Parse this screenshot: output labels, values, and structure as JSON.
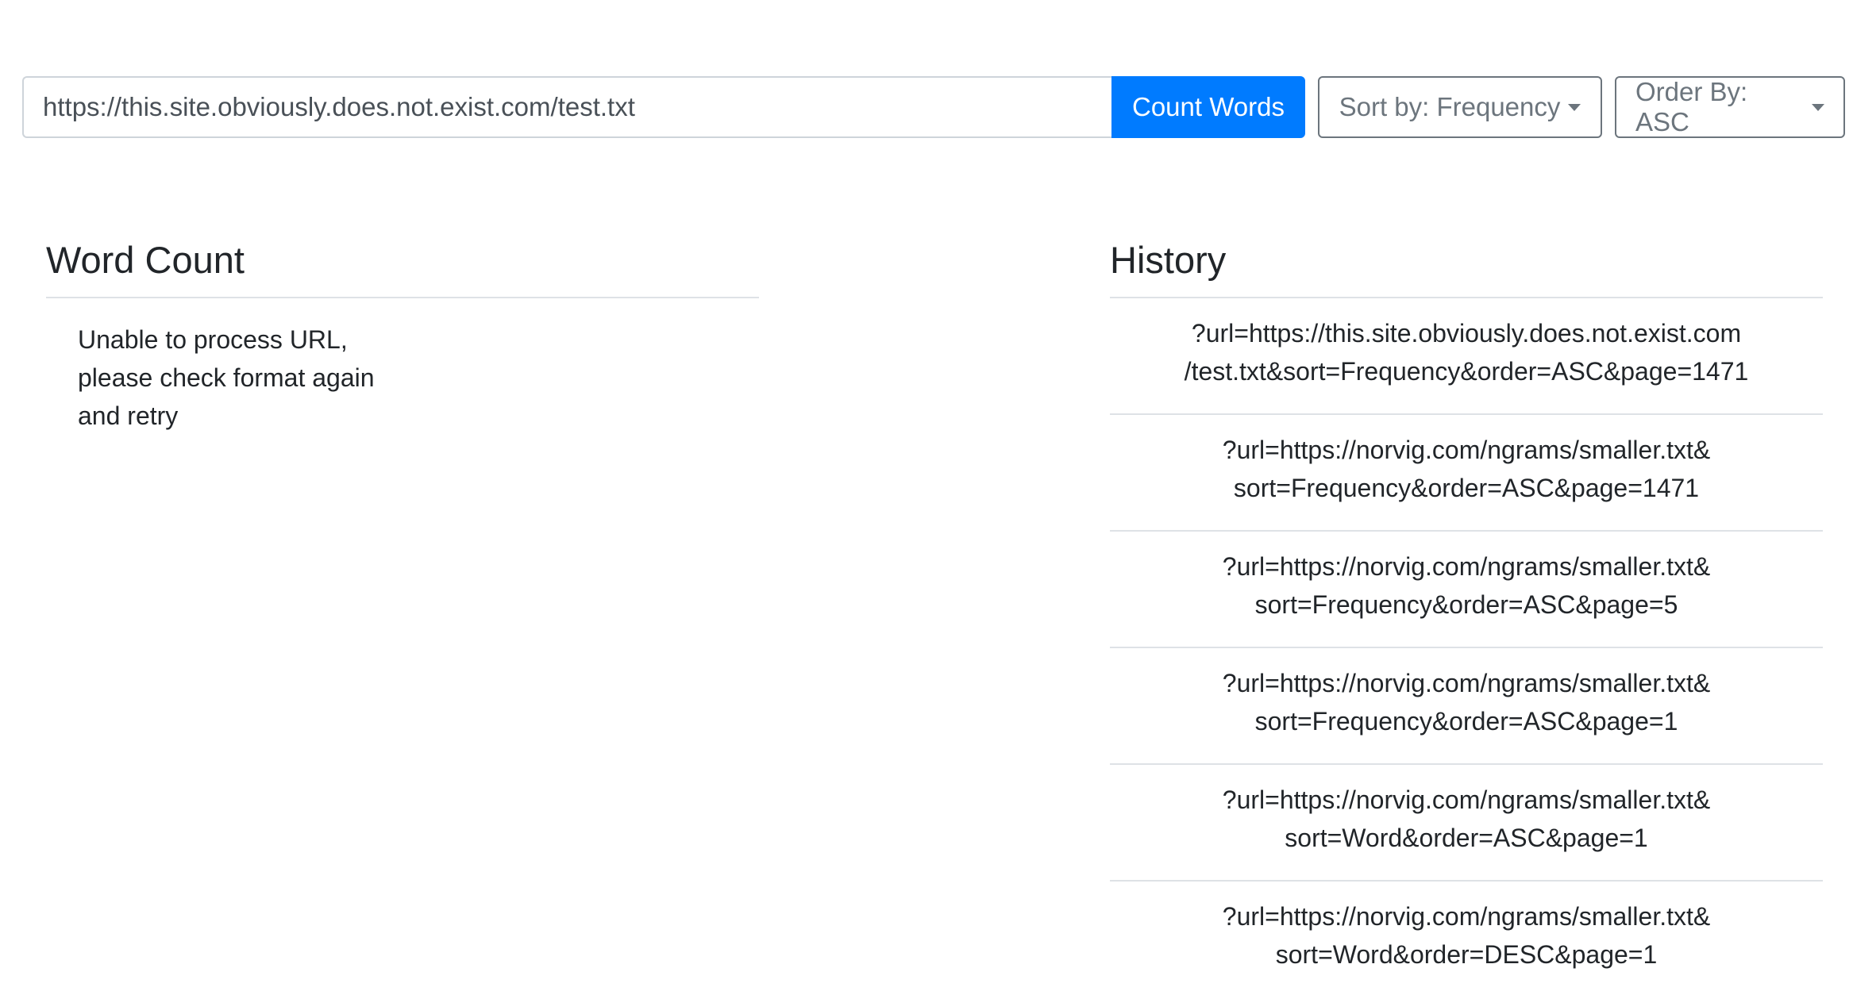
{
  "toolbar": {
    "url_value": "https://this.site.obviously.does.not.exist.com/test.txt",
    "count_button_label": "Count Words",
    "sort_dropdown_label": "Sort by: Frequency",
    "order_dropdown_label": "Order By: ASC",
    "accent_color": "#007bff"
  },
  "word_count": {
    "title": "Word Count",
    "error_message": "Unable to process URL, please check format again and retry"
  },
  "history": {
    "title": "History",
    "items": [
      {
        "line1": "?url=https://this.site.obviously.does.not.exist.com",
        "line2": "/test.txt&sort=Frequency&order=ASC&page=1471"
      },
      {
        "line1": "?url=https://norvig.com/ngrams/smaller.txt&",
        "line2": "sort=Frequency&order=ASC&page=1471"
      },
      {
        "line1": "?url=https://norvig.com/ngrams/smaller.txt&",
        "line2": "sort=Frequency&order=ASC&page=5"
      },
      {
        "line1": "?url=https://norvig.com/ngrams/smaller.txt&",
        "line2": "sort=Frequency&order=ASC&page=1"
      },
      {
        "line1": "?url=https://norvig.com/ngrams/smaller.txt&",
        "line2": "sort=Word&order=ASC&page=1"
      },
      {
        "line1": "?url=https://norvig.com/ngrams/smaller.txt&",
        "line2": "sort=Word&order=DESC&page=1"
      }
    ]
  }
}
